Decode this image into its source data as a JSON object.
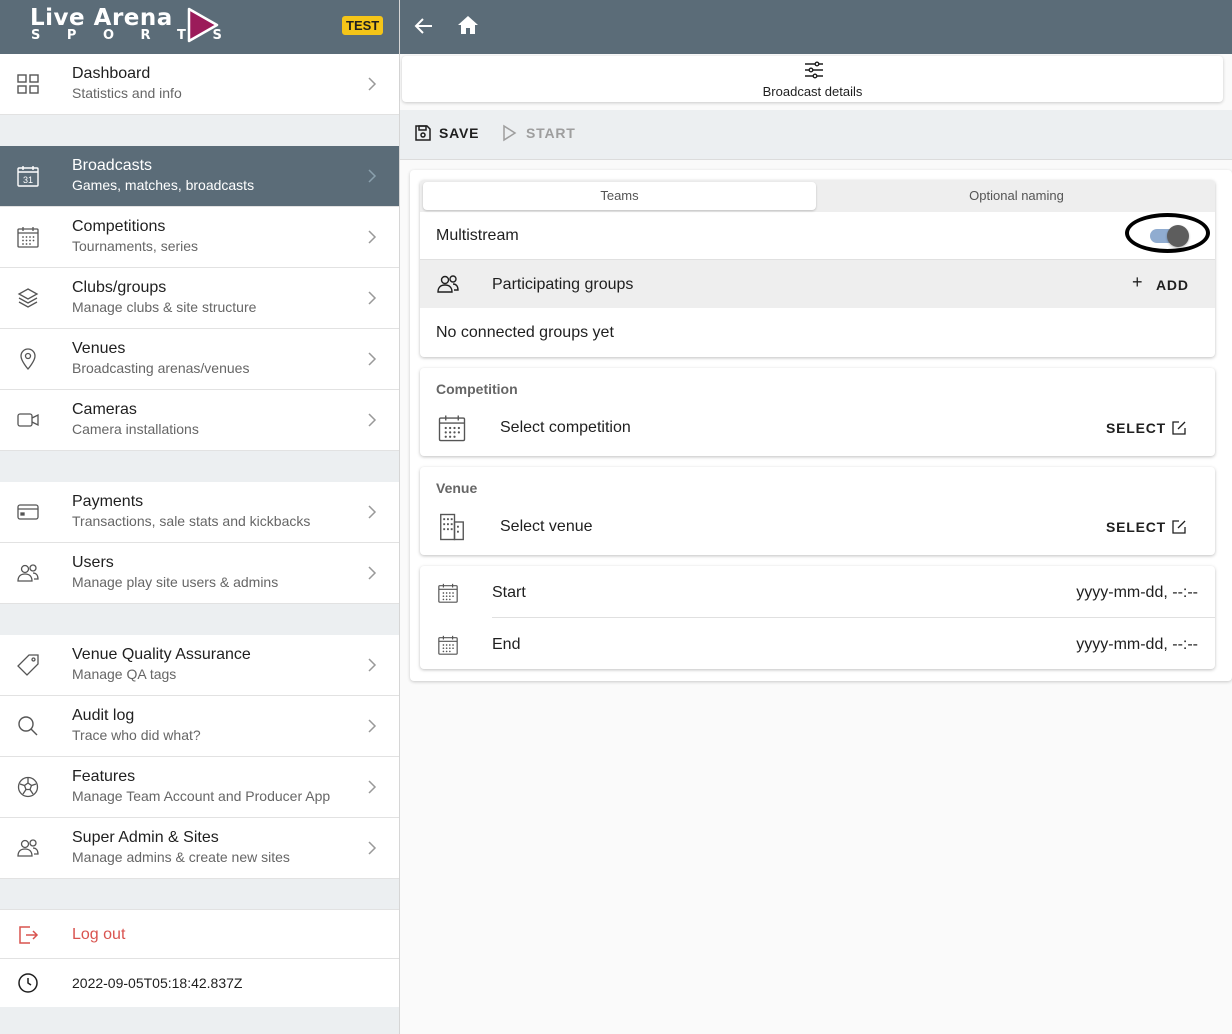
{
  "brand": {
    "name": "Live Arena",
    "sub": "S P O R T S",
    "badge": "TEST"
  },
  "nav": [
    {
      "title": "Dashboard",
      "sub": "Statistics and info",
      "icon": "dashboard-icon"
    },
    {
      "title": "Broadcasts",
      "sub": "Games, matches, broadcasts",
      "icon": "calendar-31-icon",
      "active": true
    },
    {
      "title": "Competitions",
      "sub": "Tournaments, series",
      "icon": "calendar-icon"
    },
    {
      "title": "Clubs/groups",
      "sub": "Manage clubs & site structure",
      "icon": "layers-icon"
    },
    {
      "title": "Venues",
      "sub": "Broadcasting arenas/venues",
      "icon": "location-pin-icon"
    },
    {
      "title": "Cameras",
      "sub": "Camera installations",
      "icon": "video-camera-icon"
    },
    {
      "title": "Payments",
      "sub": "Transactions, sale stats and kickbacks",
      "icon": "credit-card-icon"
    },
    {
      "title": "Users",
      "sub": "Manage play site users & admins",
      "icon": "users-icon"
    },
    {
      "title": "Venue Quality Assurance",
      "sub": "Manage QA tags",
      "icon": "tag-icon"
    },
    {
      "title": "Audit log",
      "sub": "Trace who did what?",
      "icon": "search-icon"
    },
    {
      "title": "Features",
      "sub": "Manage Team Account and Producer App",
      "icon": "soccer-ball-icon"
    },
    {
      "title": "Super Admin & Sites",
      "sub": "Manage admins & create new sites",
      "icon": "users-icon"
    }
  ],
  "logout": "Log out",
  "timestamp": "2022-09-05T05:18:42.837Z",
  "tab": {
    "label": "Broadcast details"
  },
  "actions": {
    "save": "SAVE",
    "start": "START"
  },
  "segments": {
    "a": "Teams",
    "b": "Optional naming"
  },
  "multistream": {
    "label": "Multistream",
    "enabled": true
  },
  "groups": {
    "label": "Participating groups",
    "add": "ADD",
    "empty": "No connected groups yet"
  },
  "competition": {
    "header": "Competition",
    "label": "Select competition",
    "select": "SELECT"
  },
  "venue": {
    "header": "Venue",
    "label": "Select venue",
    "select": "SELECT"
  },
  "start": {
    "label": "Start",
    "value": "yyyy-mm-dd, --:--"
  },
  "end": {
    "label": "End",
    "value": "yyyy-mm-dd, --:--"
  }
}
